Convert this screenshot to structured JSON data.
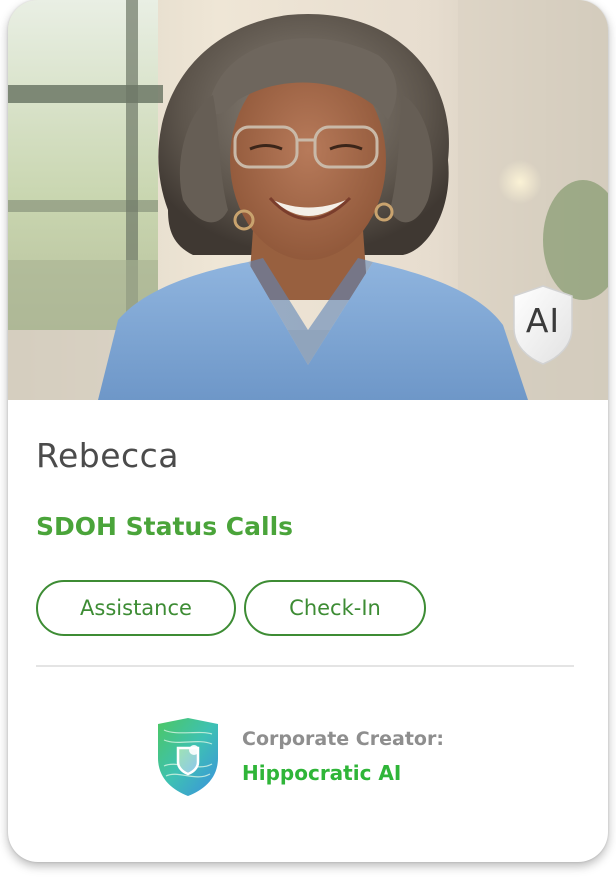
{
  "agent": {
    "name": "Rebecca",
    "role": "SDOH Status Calls",
    "ai_badge": "AI",
    "photo_icon": "portrait-photo",
    "tags": [
      {
        "label": "Assistance"
      },
      {
        "label": "Check-In"
      }
    ]
  },
  "creator": {
    "label": "Corporate Creator:",
    "name": "Hippocratic AI",
    "logo_icon": "hippocratic-shield-logo"
  },
  "colors": {
    "accent_green": "#4aa43a",
    "tag_border": "#3d8c34",
    "creator_green": "#2fb538",
    "scrubs_blue": "#7fa8d8"
  }
}
